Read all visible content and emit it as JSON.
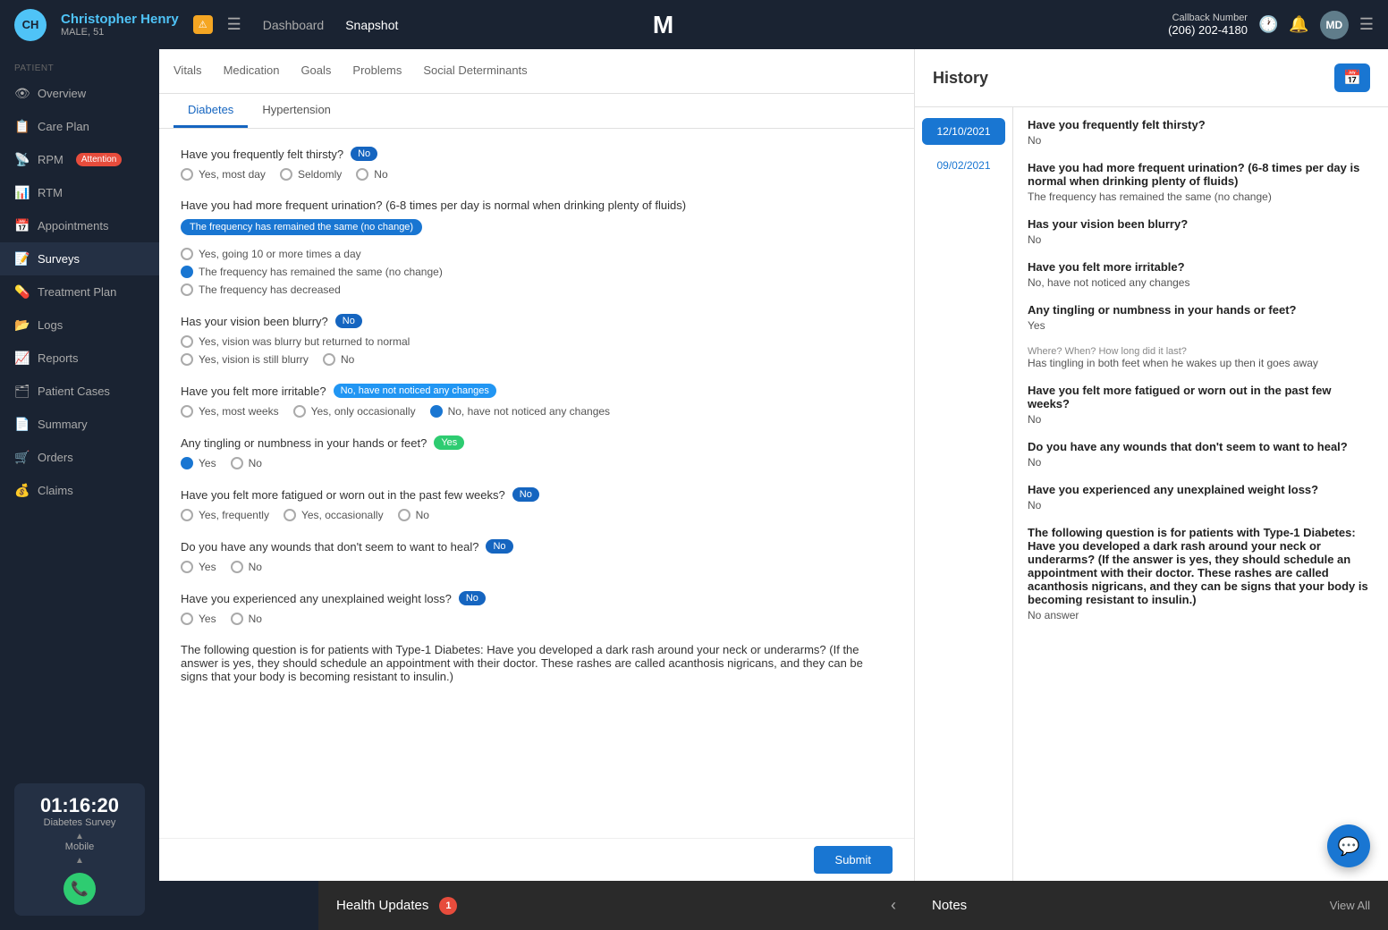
{
  "topNav": {
    "initials": "CH",
    "patientName": "Christopher Henry",
    "patientSub": "MALE, 51",
    "alertIcon": "⚠",
    "navLinks": [
      {
        "label": "Dashboard",
        "active": false
      },
      {
        "label": "Snapshot",
        "active": true
      }
    ],
    "callbackLabel": "Callback Number",
    "callbackNumber": "(206) 202-4180",
    "userInitials": "MD"
  },
  "sidebar": {
    "sectionLabel": "PATIENT",
    "items": [
      {
        "label": "Overview",
        "icon": "👁",
        "active": false
      },
      {
        "label": "Care Plan",
        "icon": "📋",
        "active": false
      },
      {
        "label": "RPM",
        "icon": "📡",
        "active": false,
        "badge": "Attention"
      },
      {
        "label": "RTM",
        "icon": "📊",
        "active": false
      },
      {
        "label": "Appointments",
        "icon": "📅",
        "active": false
      },
      {
        "label": "Surveys",
        "icon": "📝",
        "active": true
      },
      {
        "label": "Treatment Plan",
        "icon": "💊",
        "active": false
      },
      {
        "label": "Logs",
        "icon": "📂",
        "active": false
      },
      {
        "label": "Reports",
        "icon": "📈",
        "active": false
      },
      {
        "label": "Patient Cases",
        "icon": "🗂",
        "active": false
      },
      {
        "label": "Summary",
        "icon": "📄",
        "active": false
      },
      {
        "label": "Orders",
        "icon": "🛒",
        "active": false
      },
      {
        "label": "Claims",
        "icon": "💰",
        "active": false
      }
    ],
    "timer": {
      "time": "01:16:20",
      "label": "Diabetes Survey",
      "sub": "Mobile",
      "callIcon": "📞"
    }
  },
  "contentTabs": [
    {
      "label": "Vitals",
      "active": false
    },
    {
      "label": "Medication",
      "active": false
    },
    {
      "label": "Goals",
      "active": false
    },
    {
      "label": "Problems",
      "active": false
    },
    {
      "label": "Social Determinants",
      "active": false
    }
  ],
  "subTabs": [
    {
      "label": "Diabetes",
      "active": true
    },
    {
      "label": "Hypertension",
      "active": false
    }
  ],
  "questions": [
    {
      "id": "q1",
      "text": "Have you frequently felt thirsty?",
      "badge": {
        "type": "no",
        "label": "No"
      },
      "selectedTag": null,
      "options": [
        {
          "label": "Yes, most day",
          "selected": false
        },
        {
          "label": "Seldomly",
          "selected": false
        },
        {
          "label": "No",
          "selected": false
        }
      ]
    },
    {
      "id": "q2",
      "text": "Have you had more frequent urination? (6-8 times per day is normal when drinking plenty of fluids)",
      "badge": null,
      "selectedTag": "The frequency has remained the same (no change)",
      "options": [
        {
          "label": "Yes, going 10 or more times a day",
          "selected": false
        },
        {
          "label": "The frequency has remained the same (no change)",
          "selected": true
        },
        {
          "label": "The frequency has decreased",
          "selected": false
        }
      ]
    },
    {
      "id": "q3",
      "text": "Has your vision been blurry?",
      "badge": {
        "type": "no",
        "label": "No"
      },
      "selectedTag": null,
      "options": [
        {
          "label": "Yes, vision was blurry but returned to normal",
          "selected": false
        },
        {
          "label": "Yes, vision is still blurry",
          "selected": false
        },
        {
          "label": "No",
          "selected": false
        }
      ]
    },
    {
      "id": "q4",
      "text": "Have you felt more irritable?",
      "badge": {
        "type": "selected",
        "label": "No, have not noticed any changes"
      },
      "selectedTag": null,
      "options": [
        {
          "label": "Yes, most weeks",
          "selected": false
        },
        {
          "label": "Yes, only occasionally",
          "selected": false
        },
        {
          "label": "No, have not noticed any changes",
          "selected": true
        }
      ]
    },
    {
      "id": "q5",
      "text": "Any tingling or numbness in your hands or feet?",
      "badge": {
        "type": "yes",
        "label": "Yes"
      },
      "selectedTag": null,
      "options": [
        {
          "label": "Yes",
          "selected": true
        },
        {
          "label": "No",
          "selected": false
        }
      ]
    },
    {
      "id": "q6",
      "text": "Have you felt more fatigued or worn out in the past few weeks?",
      "badge": {
        "type": "no",
        "label": "No"
      },
      "selectedTag": null,
      "options": [
        {
          "label": "Yes, frequently",
          "selected": false
        },
        {
          "label": "Yes, occasionally",
          "selected": false
        },
        {
          "label": "No",
          "selected": false
        }
      ]
    },
    {
      "id": "q7",
      "text": "Do you have any wounds that don't seem to want to heal?",
      "badge": {
        "type": "no",
        "label": "No"
      },
      "selectedTag": null,
      "options": [
        {
          "label": "Yes",
          "selected": false
        },
        {
          "label": "No",
          "selected": false
        }
      ]
    },
    {
      "id": "q8",
      "text": "Have you experienced any unexplained weight loss?",
      "badge": {
        "type": "no",
        "label": "No"
      },
      "selectedTag": null,
      "options": [
        {
          "label": "Yes",
          "selected": false
        },
        {
          "label": "No",
          "selected": false
        }
      ]
    },
    {
      "id": "q9",
      "text": "The following question is for patients with Type-1 Diabetes: Have you developed a dark rash around your neck or underarms? (If the answer is yes, they should schedule an appointment with their doctor. These rashes are called acanthosis nigricans, and they can be signs that your body is becoming resistant to insulin.)",
      "badge": null,
      "selectedTag": null,
      "options": []
    }
  ],
  "history": {
    "title": "History",
    "dates": [
      {
        "label": "12/10/2021",
        "active": true
      },
      {
        "label": "09/02/2021",
        "active": false
      }
    ],
    "entries": [
      {
        "question": "Have you frequently felt thirsty?",
        "answer": "No",
        "sub": null
      },
      {
        "question": "Have you had more frequent urination? (6-8 times per day is normal when drinking plenty of fluids)",
        "answer": "The frequency has remained the same (no change)",
        "sub": null
      },
      {
        "question": "Has your vision been blurry?",
        "answer": "No",
        "sub": null
      },
      {
        "question": "Have you felt more irritable?",
        "answer": "No, have not noticed any changes",
        "sub": null
      },
      {
        "question": "Any tingling or numbness in your hands or feet?",
        "answer": "Yes",
        "sub": null
      },
      {
        "question": "Where? When? How long did it last?",
        "answer": "Has tingling in both feet when he wakes up then it goes away",
        "sub": null
      },
      {
        "question": "Have you felt more fatigued or worn out in the past few weeks?",
        "answer": "No",
        "sub": null
      },
      {
        "question": "Do you have any wounds that don't seem to want to heal?",
        "answer": "No",
        "sub": null
      },
      {
        "question": "Have you experienced any unexplained weight loss?",
        "answer": "No",
        "sub": null
      },
      {
        "question": "The following question is for patients with Type-1 Diabetes: Have you developed a dark rash around your neck or underarms? (If the answer is yes, they should schedule an appointment with their doctor. These rashes are called acanthosis nigricans, and they can be signs that your body is becoming resistant to insulin.)",
        "answer": "No answer",
        "sub": null
      }
    ]
  },
  "bottomBar": {
    "healthUpdatesLabel": "Health Updates",
    "healthBadge": "1",
    "notesLabel": "Notes",
    "viewAllLabel": "View All"
  },
  "submitLabel": "Submit"
}
